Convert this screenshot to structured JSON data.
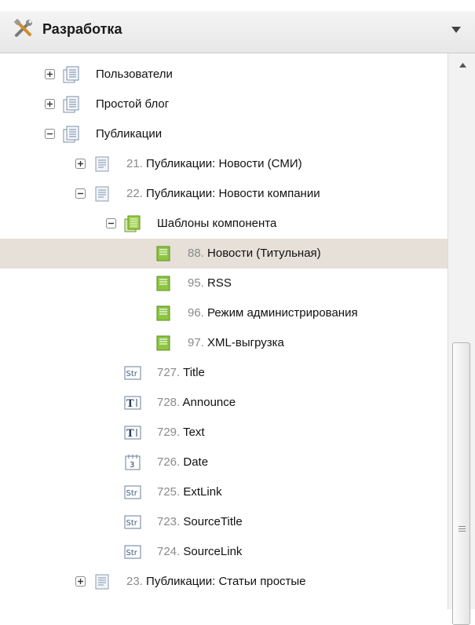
{
  "panel": {
    "title": "Разработка",
    "icon": "tools-icon",
    "dropdown_icon": "chevron-down-icon"
  },
  "tree": {
    "rows": [
      {
        "num": "",
        "label": "Пользователи",
        "expander": "plus",
        "icon": "document-list-icon"
      },
      {
        "num": "",
        "label": "Простой блог",
        "expander": "plus",
        "icon": "document-list-icon"
      },
      {
        "num": "",
        "label": "Публикации",
        "expander": "minus",
        "icon": "document-list-icon"
      },
      {
        "num": "21. ",
        "label": "Публикации: Новости (СМИ)",
        "expander": "plus",
        "icon": "document-icon"
      },
      {
        "num": "22. ",
        "label": "Публикации: Новости компании",
        "expander": "minus",
        "icon": "document-icon"
      },
      {
        "num": "",
        "label": "Шаблоны компонента",
        "expander": "minus",
        "icon": "template-folder-icon"
      },
      {
        "num": "88. ",
        "label": "Новости (Титульная)",
        "expander": "",
        "icon": "template-icon",
        "selected": true
      },
      {
        "num": "95. ",
        "label": "RSS",
        "expander": "",
        "icon": "template-icon"
      },
      {
        "num": "96. ",
        "label": "Режим администрирования",
        "expander": "",
        "icon": "template-icon"
      },
      {
        "num": "97. ",
        "label": "XML-выгрузка",
        "expander": "",
        "icon": "template-icon"
      },
      {
        "num": "727. ",
        "label": "Title",
        "expander": "",
        "icon": "string-field-icon"
      },
      {
        "num": "728. ",
        "label": "Announce",
        "expander": "",
        "icon": "text-field-icon"
      },
      {
        "num": "729. ",
        "label": "Text",
        "expander": "",
        "icon": "text-field-icon"
      },
      {
        "num": "726. ",
        "label": "Date",
        "expander": "",
        "icon": "date-field-icon"
      },
      {
        "num": "725. ",
        "label": "ExtLink",
        "expander": "",
        "icon": "string-field-icon"
      },
      {
        "num": "723. ",
        "label": "SourceTitle",
        "expander": "",
        "icon": "string-field-icon"
      },
      {
        "num": "724. ",
        "label": "SourceLink",
        "expander": "",
        "icon": "string-field-icon"
      },
      {
        "num": "23. ",
        "label": "Публикации: Статьи простые",
        "expander": "plus",
        "icon": "document-icon"
      }
    ]
  },
  "scrollbar": {
    "up_icon": "scroll-up-arrow-icon",
    "grip_icon": "scroll-grip-icon"
  },
  "colors": {
    "selected_row": "#e6e0d8",
    "number_text": "#8a8a8a",
    "template_icon": "#8cc63f"
  }
}
